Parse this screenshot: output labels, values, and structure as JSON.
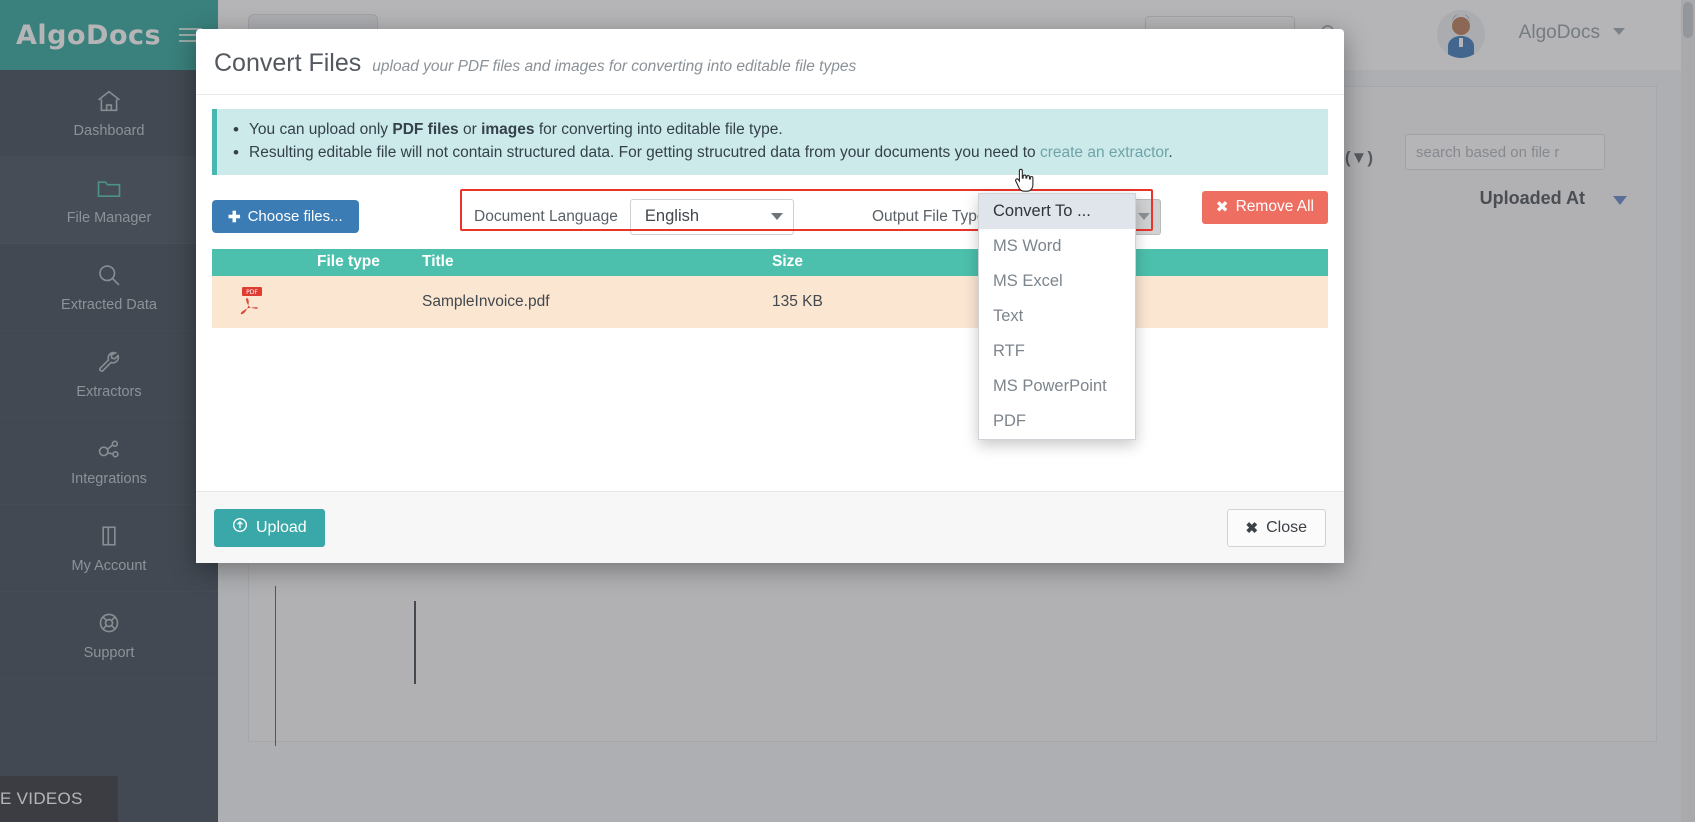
{
  "sidebar": {
    "brand": "AlgoDocs",
    "menu_icon": "hamburger-icon",
    "items": [
      {
        "label": "Dashboard",
        "icon": "home-icon",
        "active": false
      },
      {
        "label": "File Manager",
        "icon": "folder-icon",
        "active": true
      },
      {
        "label": "Extracted Data",
        "icon": "search-icon",
        "active": false
      },
      {
        "label": "Extractors",
        "icon": "wrench-icon",
        "active": false
      },
      {
        "label": "Integrations",
        "icon": "integrations-icon",
        "active": false
      },
      {
        "label": "My Account",
        "icon": "account-icon",
        "active": false
      },
      {
        "label": "Support",
        "icon": "lifebuoy-icon",
        "active": false
      }
    ],
    "videos_tab": "E VIDEOS"
  },
  "topbar": {
    "user_name": "AlgoDocs",
    "avatar": "user-avatar",
    "search_icon": "search-icon",
    "caret_icon": "chevron-down-icon"
  },
  "background": {
    "search_label": "arch:(▼)",
    "search_placeholder": "search based on file r",
    "column_header": "Uploaded At",
    "sort_caret": "caret-down-icon"
  },
  "modal": {
    "title": "Convert Files",
    "subtitle": "upload your PDF files and images for converting into editable file types",
    "info": {
      "line1_pre": "You can upload only ",
      "line1_b1": "PDF files",
      "line1_mid": " or ",
      "line1_b2": "images",
      "line1_post": " for converting into editable file type.",
      "line2_pre": "Resulting editable file will not contain structured data. For getting strucutred data from your documents you need to ",
      "line2_link": "create an extractor",
      "line2_post": "."
    },
    "toolbar": {
      "choose_files_label": "Choose files...",
      "choose_files_icon": "plus-icon",
      "document_language_label": "Document Language",
      "document_language_value": "English",
      "output_file_type_label": "Output File Type",
      "output_file_type_value": "Convert To ...",
      "remove_all_label": "Remove All",
      "remove_all_icon": "close-x-icon"
    },
    "table": {
      "headers": [
        "",
        "File type",
        "Title",
        "Size",
        ""
      ],
      "rows": [
        {
          "icon": "pdf-file-icon",
          "file_type": "",
          "title": "SampleInvoice.pdf",
          "size": "135 KB"
        }
      ]
    },
    "dropdown": {
      "open": true,
      "selected": "Convert To ...",
      "options": [
        "Convert To ...",
        "MS Word",
        "MS Excel",
        "Text",
        "RTF",
        "MS PowerPoint",
        "PDF"
      ]
    },
    "footer": {
      "upload_label": "Upload",
      "upload_icon": "upload-circle-icon",
      "close_label": "Close",
      "close_icon": "close-x-icon"
    }
  },
  "colors": {
    "brand_teal": "#1f9e94",
    "sidebar_dark": "#2f3b47",
    "table_header_teal": "#4cc0ac",
    "row_peach": "#fbe6d2",
    "info_bg": "#cdeaea",
    "danger_red": "#ef6e62",
    "primary_blue": "#3b7cb5",
    "highlight_red_border": "#e8342a",
    "upload_teal": "#3aa8a8"
  }
}
